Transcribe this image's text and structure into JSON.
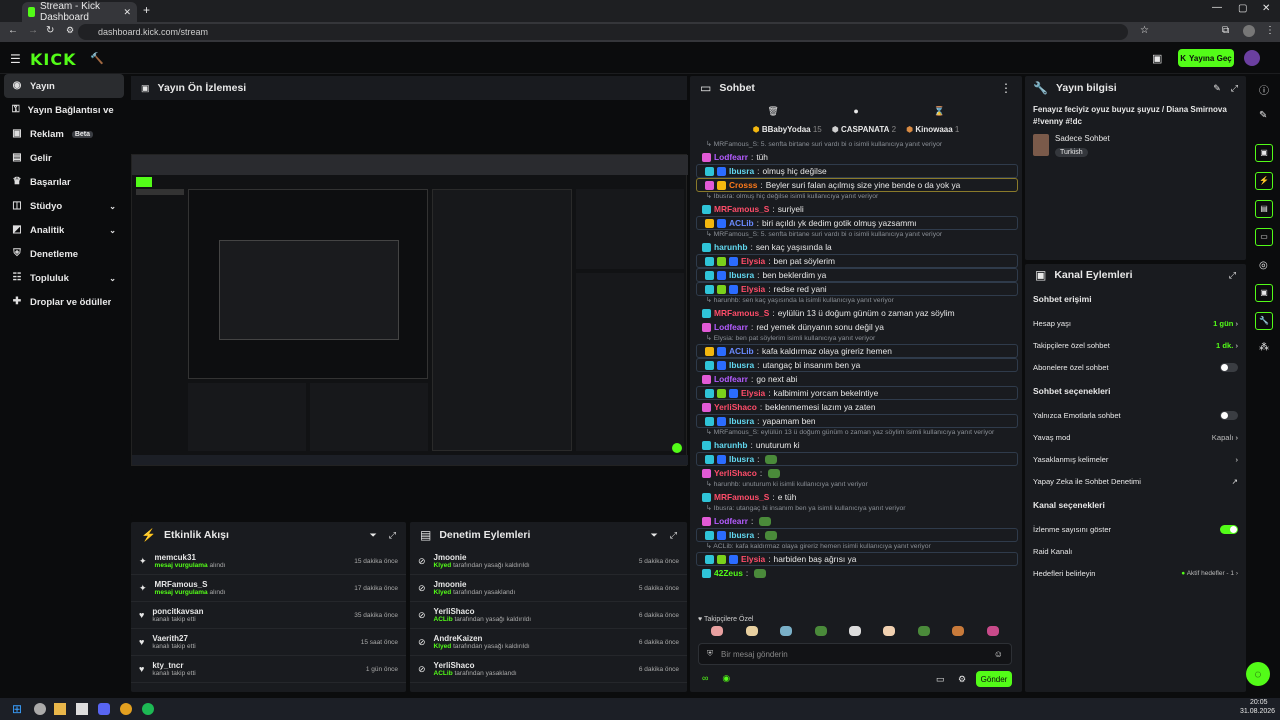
{
  "browser": {
    "tab_title": "Stream - Kick Dashboard",
    "url": "dashboard.kick.com/stream"
  },
  "top": {
    "logo": "KICK",
    "go_live": "Yayına Geç"
  },
  "sidebar": {
    "items": [
      {
        "label": "Yayın",
        "icon": "radio-icon",
        "active": true
      },
      {
        "label": "Yayın Bağlantısı ve Anahtar",
        "icon": "key-icon"
      },
      {
        "label": "Reklam",
        "icon": "ad-icon",
        "badge": "Beta"
      },
      {
        "label": "Gelir",
        "icon": "money-icon"
      },
      {
        "label": "Başarılar",
        "icon": "trophy-icon"
      },
      {
        "label": "Stüdyo",
        "icon": "studio-icon",
        "chevron": true
      },
      {
        "label": "Analitik",
        "icon": "chart-icon",
        "chevron": true
      },
      {
        "label": "Denetleme",
        "icon": "shield-icon"
      },
      {
        "label": "Topluluk",
        "icon": "users-icon",
        "chevron": true
      },
      {
        "label": "Droplar ve ödüller",
        "icon": "gift-icon"
      }
    ]
  },
  "preview": {
    "title": "Yayın Ön İzlemesi"
  },
  "activity": {
    "title": "Etkinlik Akışı",
    "items": [
      {
        "user": "memcuk31",
        "action": "mesaj vurgulama",
        "suffix": "alındı",
        "time": "15 dakika önce",
        "icon": "sparkle-icon"
      },
      {
        "user": "MRFamous_S",
        "action": "mesaj vurgulama",
        "suffix": "alındı",
        "time": "17 dakika önce",
        "icon": "sparkle-icon"
      },
      {
        "user": "poncitkavsan",
        "action": "",
        "suffix": "kanalı takip etti",
        "time": "35 dakika önce",
        "icon": "heart-icon"
      },
      {
        "user": "Vaerith27",
        "action": "",
        "suffix": "kanalı takip etti",
        "time": "15 saat önce",
        "icon": "heart-icon"
      },
      {
        "user": "kty_tncr",
        "action": "",
        "suffix": "kanalı takip etti",
        "time": "1 gün önce",
        "icon": "heart-icon"
      }
    ]
  },
  "modlog": {
    "title": "Denetim Eylemleri",
    "items": [
      {
        "user": "Jmoonie",
        "mod": "Klyed",
        "text": "tarafından yasağı kaldırıldı",
        "time": "5 dakika önce"
      },
      {
        "user": "Jmoonie",
        "mod": "Klyed",
        "text": "tarafından yasaklandı",
        "time": "5 dakika önce"
      },
      {
        "user": "YerliShaco",
        "mod": "ACLib",
        "text": "tarafından yasağı kaldırıldı",
        "time": "6 dakika önce"
      },
      {
        "user": "AndreKaizen",
        "mod": "Klyed",
        "text": "tarafından yasağı kaldırıldı",
        "time": "6 dakika önce"
      },
      {
        "user": "YerliShaco",
        "mod": "ACLib",
        "text": "tarafından yasaklandı",
        "time": "6 dakika önce"
      }
    ]
  },
  "chat": {
    "title": "Sohbet",
    "top_gifters": [
      {
        "name": "BBabyYodaa",
        "count": "15"
      },
      {
        "name": "CASPANATA",
        "count": "2"
      },
      {
        "name": "Kinowaaa",
        "count": "1"
      }
    ],
    "messages": [
      {
        "reply": "MRFamous_S: 5. senfta birtane suri vardı bi o isimli kullanıcıya yanıt veriyor"
      },
      {
        "user": "Lodfearr",
        "color": "#b45cff",
        "text": "tüh",
        "badges": [
          "#e25ad6"
        ]
      },
      {
        "user": "Ibusra",
        "color": "#62d8f0",
        "text": "olmuş hiç değilse",
        "badges": [
          "#2fc4d8",
          "#2b6cff"
        ],
        "box": true
      },
      {
        "user": "Crosss",
        "color": "#ff7a1a",
        "text": "Beyler suri falan açılmış size yine bende o da yok ya",
        "badges": [
          "#e25ad6",
          "#f3b70f"
        ],
        "box": true,
        "gold": true
      },
      {
        "reply": "Ibusra: olmuş hiç değilse isimli kullanıcıya yanıt veriyor"
      },
      {
        "user": "MRFamous_S",
        "color": "#ff4d6a",
        "text": "suriyeli",
        "badges": [
          "#2fc4d8"
        ]
      },
      {
        "user": "ACLib",
        "color": "#6a8bff",
        "text": "biri açıldı yk dedim gotik olmuş yazsammı",
        "badges": [
          "#f3b70f",
          "#2b6cff"
        ],
        "box": true
      },
      {
        "reply": "MRFamous_S: 5. senfta birtane suri vardı bi o isimli kullanıcıya yanıt veriyor"
      },
      {
        "user": "harunhb",
        "color": "#62d8f0",
        "text": "sen kaç yaşısında la",
        "badges": [
          "#2fc4d8"
        ]
      },
      {
        "user": "Elysia",
        "color": "#ff4d6a",
        "text": "ben pat söylerim",
        "badges": [
          "#2fc4d8",
          "#7bd11b",
          "#2b6cff"
        ],
        "box": true
      },
      {
        "user": "Ibusra",
        "color": "#62d8f0",
        "text": "ben beklerdim ya",
        "badges": [
          "#2fc4d8",
          "#2b6cff"
        ],
        "box": true
      },
      {
        "user": "Elysia",
        "color": "#ff4d6a",
        "text": "redse red yani",
        "badges": [
          "#2fc4d8",
          "#7bd11b",
          "#2b6cff"
        ],
        "box": true
      },
      {
        "reply": "harunhb: sen kaç yaşısında la isimli kullanıcıya yanıt veriyor"
      },
      {
        "user": "MRFamous_S",
        "color": "#ff4d6a",
        "text": "eylülün 13 ü doğum günüm o zaman yaz söylim",
        "badges": [
          "#2fc4d8"
        ]
      },
      {
        "user": "Lodfearr",
        "color": "#b45cff",
        "text": "red yemek dünyanın sonu değil ya",
        "badges": [
          "#e25ad6"
        ]
      },
      {
        "reply": "Elysia: ben pat söylerim isimli kullanıcıya yanıt veriyor"
      },
      {
        "user": "ACLib",
        "color": "#6a8bff",
        "text": "kafa kaldırmaz olaya gireriz hemen",
        "badges": [
          "#f3b70f",
          "#2b6cff"
        ],
        "box": true
      },
      {
        "user": "Ibusra",
        "color": "#62d8f0",
        "text": "utangaç bi insanım ben ya",
        "badges": [
          "#2fc4d8",
          "#2b6cff"
        ],
        "box": true
      },
      {
        "user": "Lodfearr",
        "color": "#b45cff",
        "text": "go next abi",
        "badges": [
          "#e25ad6"
        ]
      },
      {
        "user": "Elysia",
        "color": "#ff4d6a",
        "text": "kalbimimi yorcam bekelntiye",
        "badges": [
          "#2fc4d8",
          "#7bd11b",
          "#2b6cff"
        ],
        "box": true
      },
      {
        "user": "YerliShaco",
        "color": "#ff4d6a",
        "text": "beklenmemesi lazım ya zaten",
        "badges": [
          "#e25ad6"
        ]
      },
      {
        "user": "Ibusra",
        "color": "#62d8f0",
        "text": "yapamam ben",
        "badges": [
          "#2fc4d8",
          "#2b6cff"
        ],
        "box": true
      },
      {
        "reply": "MRFamous_S: eylülün 13 ü doğum günüm o zaman yaz söylim isimli kullanıcıya yanıt veriyor"
      },
      {
        "user": "harunhb",
        "color": "#62d8f0",
        "text": "unuturum ki",
        "badges": [
          "#2fc4d8"
        ]
      },
      {
        "user": "Ibusra",
        "color": "#62d8f0",
        "text": "",
        "badges": [
          "#2fc4d8",
          "#2b6cff"
        ],
        "box": true,
        "emote": true
      },
      {
        "user": "YerliShaco",
        "color": "#ff4d6a",
        "text": "",
        "badges": [
          "#e25ad6"
        ],
        "emote": true
      },
      {
        "reply": "harunhb: unuturum ki isimli kullanıcıya yanıt veriyor"
      },
      {
        "user": "MRFamous_S",
        "color": "#ff4d6a",
        "text": "e tüh",
        "badges": [
          "#2fc4d8"
        ]
      },
      {
        "reply": "Ibusra: utangaç bi insanım ben ya isimli kullanıcıya yanıt veriyor"
      },
      {
        "user": "Lodfearr",
        "color": "#b45cff",
        "text": "",
        "badges": [
          "#e25ad6"
        ],
        "emote": true
      },
      {
        "user": "Ibusra",
        "color": "#62d8f0",
        "text": "",
        "badges": [
          "#2fc4d8",
          "#2b6cff"
        ],
        "box": true,
        "emote": true
      },
      {
        "reply": "ACLib: kafa kaldırmaz olaya gireriz hemen isimli kullanıcıya yanıt veriyor"
      },
      {
        "user": "Elysia",
        "color": "#ff4d6a",
        "text": "harbiden baş ağrısı ya",
        "badges": [
          "#2fc4d8",
          "#7bd11b",
          "#2b6cff"
        ],
        "box": true
      },
      {
        "user": "42Zeus",
        "color": "#53fc18",
        "text": "",
        "badges": [
          "#2fc4d8"
        ],
        "emote": true
      }
    ],
    "emote_section": "Takipçilere Özel",
    "input_placeholder": "Bir mesaj gönderin",
    "send": "Gönder"
  },
  "stream_info": {
    "title": "Yayın bilgisi",
    "stream_title": "Fenayız feciyiz oyuz buyuz şuyuz / Diana Smirnova #!venny #!dc",
    "category": "Sadece Sohbet",
    "tag": "Turkish"
  },
  "channel_actions": {
    "title": "Kanal Eylemleri",
    "chat_access": "Sohbet erişimi",
    "account_age": {
      "label": "Hesap yaşı",
      "value": "1 gün"
    },
    "followers_only": {
      "label": "Takipçilere özel sohbet",
      "value": "1 dk."
    },
    "subs_only": {
      "label": "Abonelere özel sohbet",
      "on": false
    },
    "chat_options": "Sohbet seçenekleri",
    "emote_only": {
      "label": "Yalnızca Emotlarla sohbet",
      "on": false
    },
    "slow_mode": {
      "label": "Yavaş mod",
      "value": "Kapalı"
    },
    "banned_words": {
      "label": "Yasaklanmış kelimeler"
    },
    "ai_mod": {
      "label": "Yapay Zeka ile Sohbet Denetimi"
    },
    "channel_options": "Kanal seçenekleri",
    "viewer_count": {
      "label": "İzlenme sayısını göster",
      "on": true
    },
    "raid": {
      "label": "Raid Kanalı"
    },
    "goals": {
      "label": "Hedefleri belirleyin",
      "value": "Aktif hedefler - 1"
    }
  },
  "taskbar": {
    "time": "20:05",
    "date": "31.08.2026"
  },
  "colors": {
    "accent": "#53fc18",
    "bg": "#0b0c0d",
    "panel": "#191b1f"
  }
}
